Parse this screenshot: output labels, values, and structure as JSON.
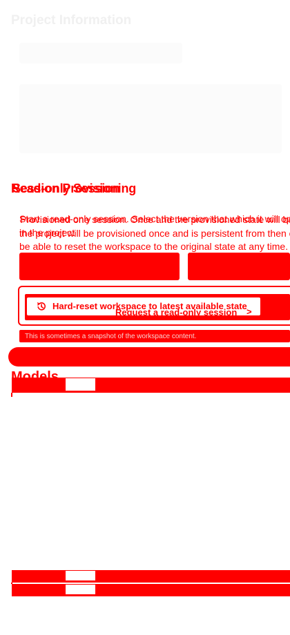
{
  "project": {
    "title": "Project Information"
  },
  "session": {
    "heading_layers": [
      "Read-only Session",
      "Session Provisioning"
    ],
    "description_layers": [
      [
        "Start a read-only session. Select the version that which it will open",
        "in the project"
      ],
      [
        "Provisioned one session. Once and the provisioned state will be",
        "the project will be provisioned once and is persistent from then on.",
        "be able to reset the workspace to the original state at any time."
      ]
    ],
    "hard_reset_label": "Hard-reset workspace to latest available state",
    "request_label": "Request a read-only session",
    "request_chevron": ">"
  },
  "footnote": "This is sometimes a snapshot of the workspace content.",
  "models": {
    "heading": "Models"
  },
  "icons": {
    "hard_reset_icon": "history-icon",
    "request_icon": "chevron-right-icon"
  },
  "colors": {
    "accent": "#ff0000",
    "background": "#ffffff",
    "faded_title": "#f0f0f0"
  }
}
